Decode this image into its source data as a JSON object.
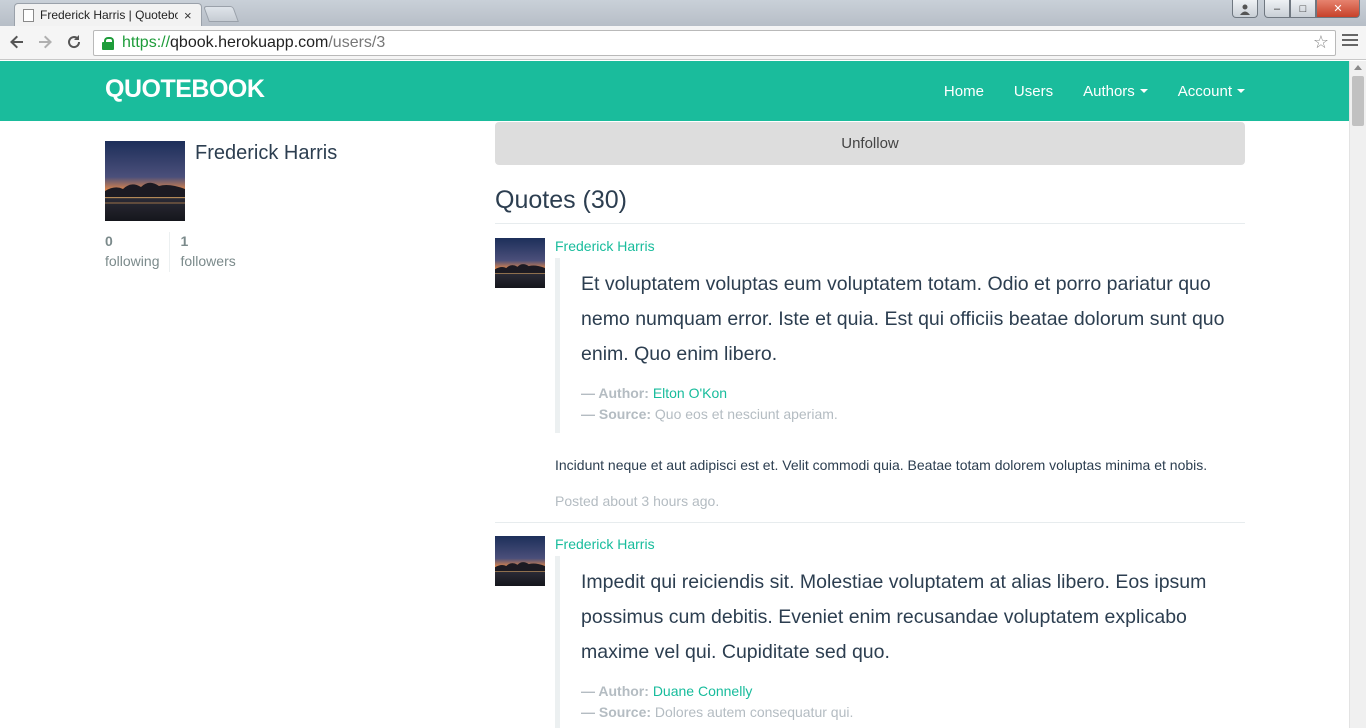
{
  "browser": {
    "tab_title": "Frederick Harris | Quotebook",
    "tab_close": "×",
    "url_scheme": "https://",
    "url_host": "qbook.herokuapp.com",
    "url_path": "/users/3",
    "min_glyph": "–",
    "max_glyph": "□",
    "close_glyph": "✕"
  },
  "navbar": {
    "brand": "QUOTEBOOK",
    "links": [
      {
        "label": "Home"
      },
      {
        "label": "Users"
      },
      {
        "label": "Authors",
        "dropdown": true
      },
      {
        "label": "Account",
        "dropdown": true
      }
    ]
  },
  "profile": {
    "name": "Frederick Harris",
    "following_count": "0",
    "following_label": "following",
    "followers_count": "1",
    "followers_label": "followers"
  },
  "main": {
    "unfollow_label": "Unfollow",
    "quotes_heading": "Quotes (30)"
  },
  "posts": [
    {
      "user": "Frederick Harris",
      "quote": "Et voluptatem voluptas eum voluptatem totam. Odio et porro pariatur quo nemo numquam error. Iste et quia. Est qui officiis beatae dolorum sunt quo enim. Quo enim libero.",
      "author_prefix": "— Author:",
      "author": "Elton O'Kon",
      "source_prefix": "— Source:",
      "source": "Quo eos et nesciunt aperiam.",
      "body": "Incidunt neque et aut adipisci est et. Velit commodi quia. Beatae totam dolorem voluptas minima et nobis.",
      "time": "Posted about 3 hours ago."
    },
    {
      "user": "Frederick Harris",
      "quote": "Impedit qui reiciendis sit. Molestiae voluptatem at alias libero. Eos ipsum possimus cum debitis. Eveniet enim recusandae voluptatem explicabo maxime vel qui. Cupiditate sed quo.",
      "author_prefix": "— Author:",
      "author": "Duane Connelly",
      "source_prefix": "— Source:",
      "source": "Dolores autem consequatur qui."
    }
  ],
  "colors": {
    "navbar": "#1abc9c",
    "link": "#18bc9c",
    "text": "#2c3e50",
    "muted": "#b4bcc2"
  }
}
